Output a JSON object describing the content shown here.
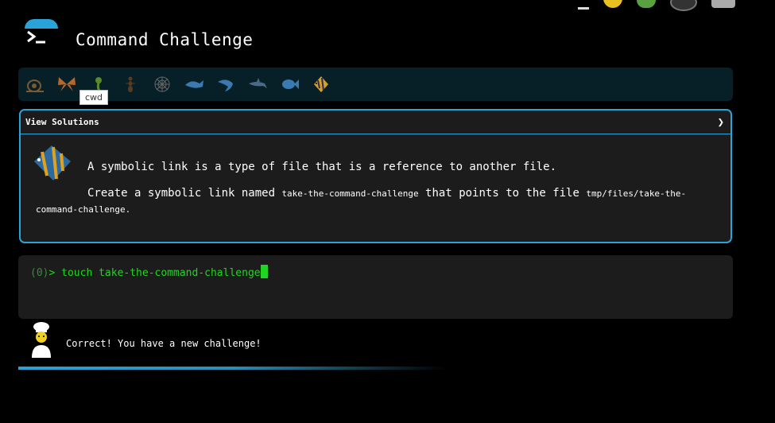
{
  "header": {
    "title": "Command Challenge"
  },
  "levels": {
    "items": [
      {
        "name": "snail"
      },
      {
        "name": "butterfly"
      },
      {
        "name": "worm"
      },
      {
        "name": "ant"
      },
      {
        "name": "spider-web"
      },
      {
        "name": "whale"
      },
      {
        "name": "shark"
      },
      {
        "name": "dolphin"
      },
      {
        "name": "fish"
      },
      {
        "name": "angelfish"
      }
    ],
    "tooltip": "cwd"
  },
  "challenge": {
    "view_solutions": "View Solutions",
    "chevron": "❯",
    "description": "A symbolic link is a type of file that is a reference to another file.",
    "task_prefix": "Create a symbolic link named ",
    "link_name": "take-the-command-challenge",
    "task_middle": " that points to the file ",
    "target_part1": "tmp/files/take-the-",
    "target_part2": "command-challenge",
    "task_end": "."
  },
  "terminal": {
    "prompt_num": "(0)",
    "prompt_arrow": "> ",
    "command": "touch take-the-command-challenge"
  },
  "feedback": {
    "message": "Correct! You have a new challenge!"
  },
  "progress": {
    "fraction": 0.55
  },
  "colors": {
    "accent": "#2aa3d8",
    "terminal_green": "#22d422",
    "panel_bg": "#1c1c1c",
    "levels_bg": "#072028"
  }
}
